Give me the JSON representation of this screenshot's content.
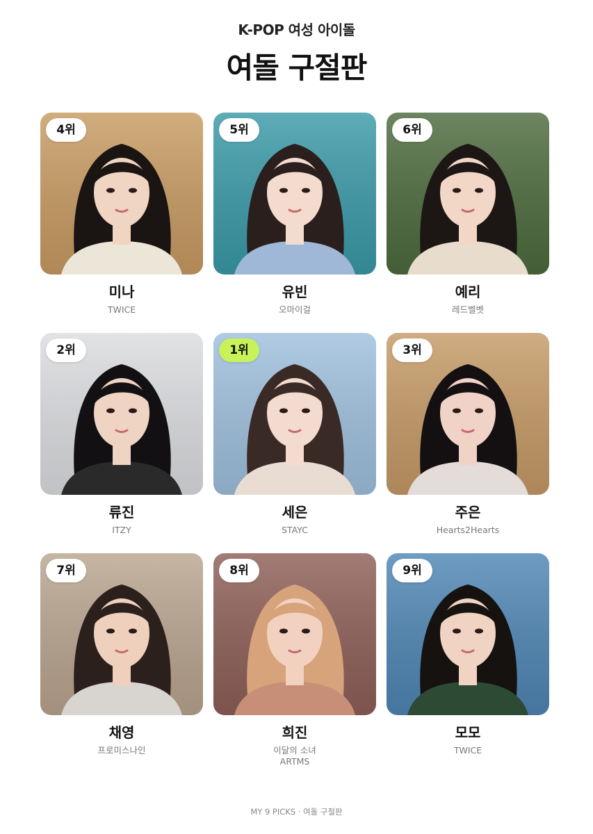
{
  "header": {
    "subtitle": "K-POP 여성 아이돌",
    "title": "여돌 구절판"
  },
  "cards": [
    {
      "rank": "4위",
      "name": "미나",
      "group": "TWICE",
      "bg": "#c89b62",
      "hair": "#1a1412",
      "skin": "#f0d5c2",
      "cloth": "#ece6d8"
    },
    {
      "rank": "5위",
      "name": "유빈",
      "group": "오마이걸",
      "bg": "#3a9aa8",
      "hair": "#2a1f1c",
      "skin": "#f3dccd",
      "cloth": "#9fb8d8"
    },
    {
      "rank": "6위",
      "name": "예리",
      "group": "레드벨벳",
      "bg": "#4d6b3e",
      "hair": "#1c1614",
      "skin": "#f2d7c6",
      "cloth": "#e8dccd"
    },
    {
      "rank": "2위",
      "name": "류진",
      "group": "ITZY",
      "bg": "#dcdde0",
      "hair": "#121012",
      "skin": "#f0d4c3",
      "cloth": "#2a2a2a"
    },
    {
      "rank": "1위",
      "name": "세은",
      "group": "STAYC",
      "bg": "#9fc0dd",
      "hair": "#3a2a26",
      "skin": "#f4dbd0",
      "cloth": "#e9ddd3",
      "top": true
    },
    {
      "rank": "3위",
      "name": "주은",
      "group": "Hearts2Hearts",
      "bg": "#c59a66",
      "hair": "#141012",
      "skin": "#f1d2c6",
      "cloth": "#e3dcd8"
    },
    {
      "rank": "7위",
      "name": "채영",
      "group": "프로미스나인",
      "bg": "#b9a58f",
      "hair": "#2b201c",
      "skin": "#efd0bd",
      "cloth": "#d8d4cf"
    },
    {
      "rank": "8위",
      "name": "희진",
      "group": "이달의 소녀\nARTMS",
      "bg": "#8e5f58",
      "hair": "#d6a37a",
      "skin": "#f3d1c0",
      "cloth": "#c78f78"
    },
    {
      "rank": "9위",
      "name": "모모",
      "group": "TWICE",
      "bg": "#4f86b4",
      "hair": "#15120f",
      "skin": "#f0d3c2",
      "cloth": "#2d4a35"
    }
  ],
  "footer": {
    "text": "MY 9 PICKS · 여돌 구절판"
  }
}
